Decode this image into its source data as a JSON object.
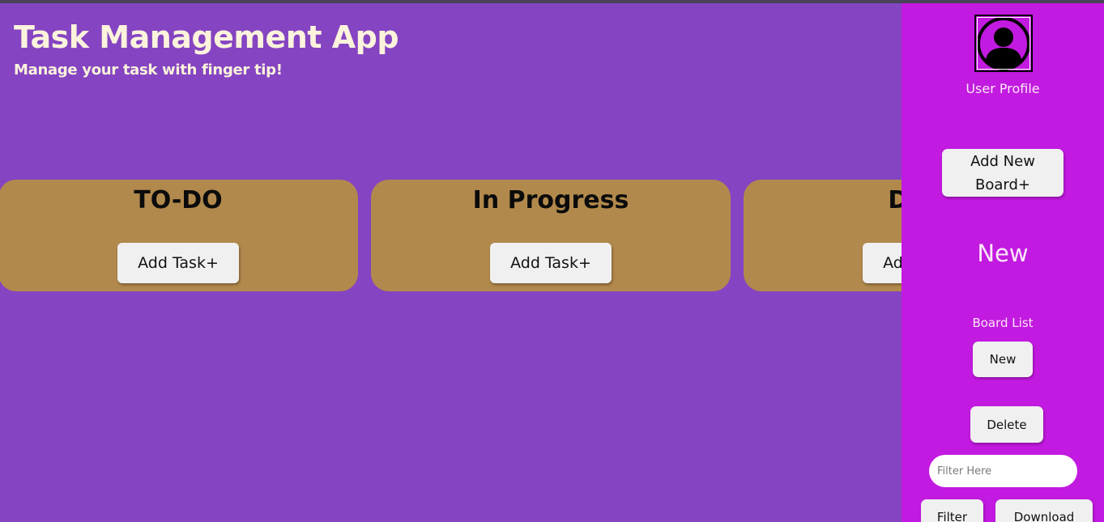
{
  "header": {
    "title": "Task Management App",
    "subtitle": "Manage your task with finger tip!"
  },
  "columns": [
    {
      "title": "TO-DO",
      "add_label": "Add Task+"
    },
    {
      "title": "In Progress",
      "add_label": "Add Task+"
    },
    {
      "title": "Done",
      "add_label": "Add Task+"
    }
  ],
  "sidebar": {
    "avatar_icon": "user-avatar-icon",
    "profile_label": "User Profile",
    "add_board_line1": "Add New",
    "add_board_line2": "Board+",
    "active_board": "New",
    "board_list_label": "Board List",
    "boards": [
      "New"
    ],
    "delete_label": "Delete",
    "filter_placeholder": "Filter Here",
    "filter_label": "Filter",
    "download_label": "Download"
  },
  "colors": {
    "background": "#8544c2",
    "sidebar": "#c21ae0",
    "column": "#b2894c",
    "title_text": "#fbf3dc"
  }
}
